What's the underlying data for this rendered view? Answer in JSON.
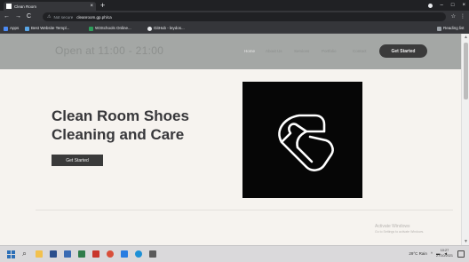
{
  "browser": {
    "tab_title": "Clean Room",
    "tab_close": "×",
    "new_tab": "+",
    "window_controls": {
      "minimize": "–",
      "maximize": "□",
      "close": "×"
    },
    "nav": {
      "back": "←",
      "forward": "→",
      "reload": "C"
    },
    "address": {
      "security_label": "Not secure",
      "url": "cleanroom.gp.ph/ca"
    },
    "bookmarks": [
      {
        "label": "Apps",
        "color": "#4c8bf5"
      },
      {
        "label": "Best Website Templ...",
        "color": "#5aa6e6"
      },
      {
        "label": "W3Schools Online...",
        "color": "#2e9d5b"
      },
      {
        "label": "GitHub - leydos...",
        "color": "#e8eaed"
      }
    ],
    "reading_list": "Reading list"
  },
  "site": {
    "hours": "Open at 11:00 - 21:00",
    "nav": [
      "Home",
      "About Us",
      "Services",
      "Portfolio",
      "Contact"
    ],
    "header_button": "Get Started",
    "hero": {
      "title": "Clean Room Shoes Cleaning and Care",
      "button": "Get Started"
    },
    "watermark": {
      "line1": "Activate Windows",
      "line2": "Go to Settings to activate Windows."
    }
  },
  "taskbar": {
    "search_icon": "⌕",
    "tray_text": "29°C  Rain",
    "time": "10:27",
    "date": "27/10/2021"
  },
  "colors": {
    "header_bg": "#a4a7a5",
    "page_bg": "#f6f3ef",
    "button_bg": "#3a3a3a",
    "logo_bg": "#060606"
  }
}
